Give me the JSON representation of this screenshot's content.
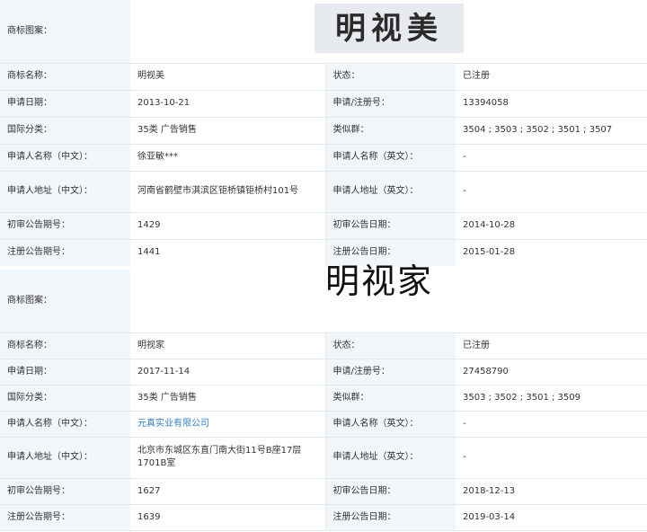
{
  "records": [
    {
      "logo_label": "商标图案：",
      "logo_text": "明视美",
      "rows": [
        {
          "l1": "商标名称：",
          "v1": "明视美",
          "l2": "状态：",
          "v2": "已注册"
        },
        {
          "l1": "申请日期：",
          "v1": "2013-10-21",
          "l2": "申请/注册号：",
          "v2": "13394058"
        },
        {
          "l1": "国际分类：",
          "v1": "35类 广告销售",
          "l2": "类似群：",
          "v2": "3504 ; 3503 ; 3502 ; 3501 ; 3507"
        },
        {
          "l1": "申请人名称（中文）：",
          "v1": "徐亚敏***",
          "l2": "申请人名称（英文）：",
          "v2": "-"
        },
        {
          "l1": "申请人地址（中文）：",
          "v1": "河南省鹤壁市淇滨区钜桥镇钜桥村101号",
          "l2": "申请人地址（英文）：",
          "v2": "-"
        },
        {
          "l1": "初审公告期号：",
          "v1": "1429",
          "l2": "初审公告日期：",
          "v2": "2014-10-28"
        },
        {
          "l1": "注册公告期号：",
          "v1": "1441",
          "l2": "注册公告日期：",
          "v2": "2015-01-28"
        }
      ]
    },
    {
      "logo_label": "商标图案：",
      "logo_text": "明视家",
      "rows": [
        {
          "l1": "商标名称：",
          "v1": "明视家",
          "l2": "状态：",
          "v2": "已注册"
        },
        {
          "l1": "申请日期：",
          "v1": "2017-11-14",
          "l2": "申请/注册号：",
          "v2": "27458790"
        },
        {
          "l1": "国际分类：",
          "v1": "35类 广告销售",
          "l2": "类似群：",
          "v2": "3503 ; 3502 ; 3501 ; 3509"
        },
        {
          "l1": "申请人名称（中文）：",
          "v1": "元真实业有限公司",
          "l2": "申请人名称（英文）：",
          "v2": "-"
        },
        {
          "l1": "申请人地址（中文）：",
          "v1": "北京市东城区东直门南大街11号B座17层1701B室",
          "l2": "申请人地址（英文）：",
          "v2": "-"
        },
        {
          "l1": "初审公告期号：",
          "v1": "1627",
          "l2": "初审公告日期：",
          "v2": "2018-12-13"
        },
        {
          "l1": "注册公告期号：",
          "v1": "1639",
          "l2": "注册公告日期：",
          "v2": "2019-03-14"
        }
      ]
    }
  ]
}
